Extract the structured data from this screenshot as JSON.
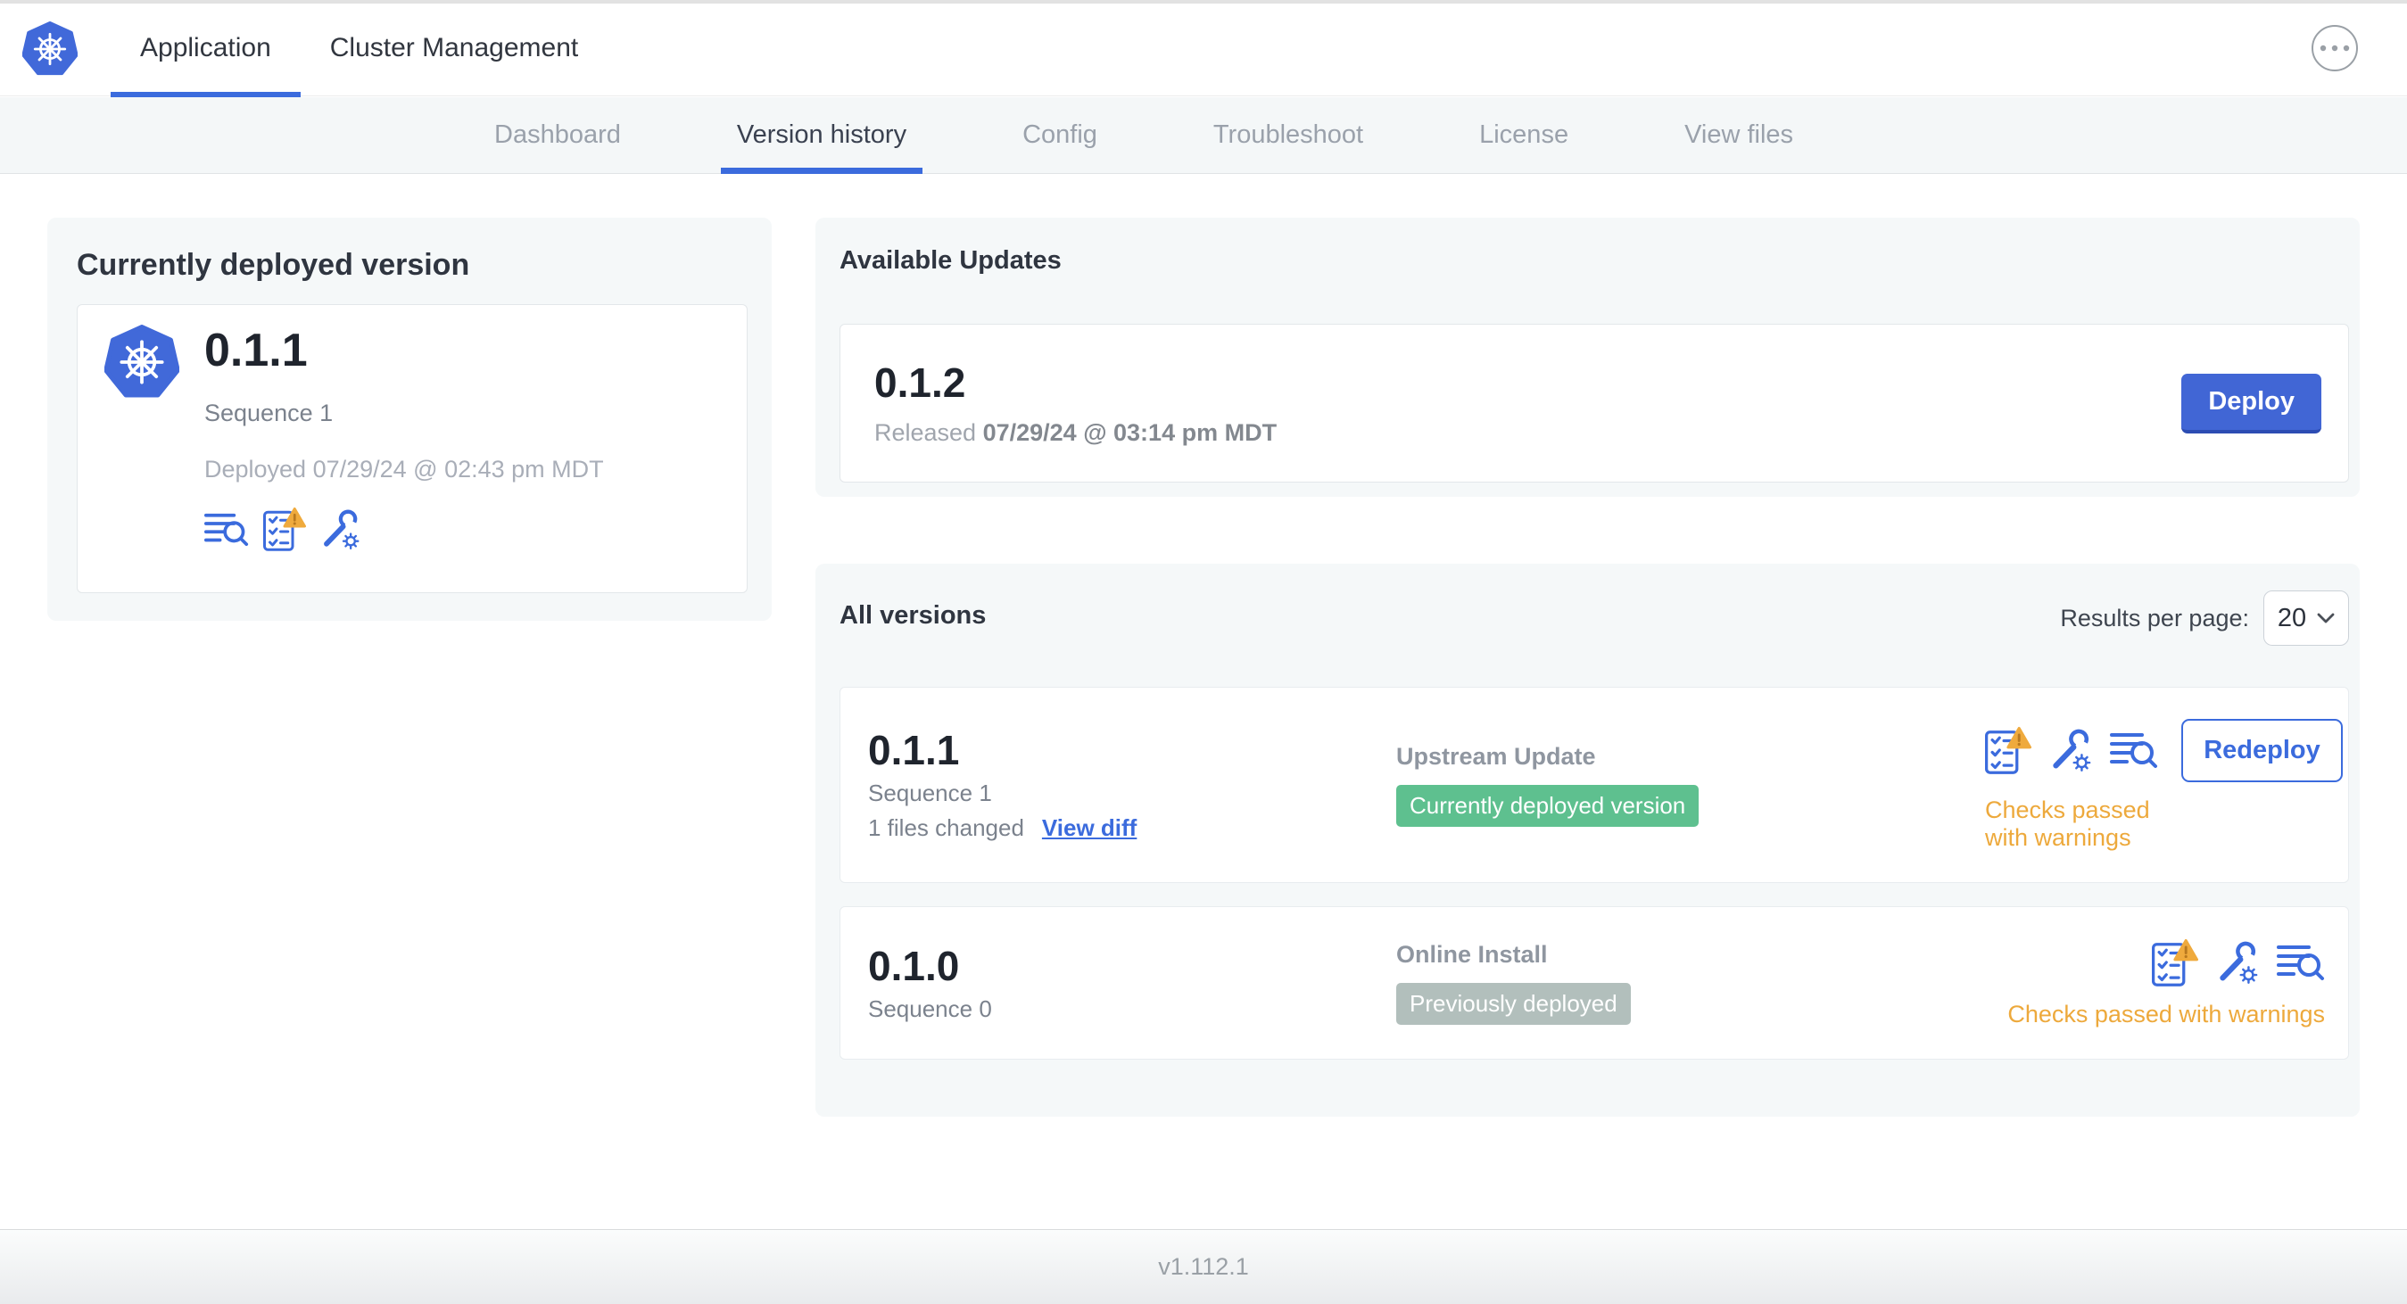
{
  "header": {
    "tabs": [
      {
        "label": "Application"
      },
      {
        "label": "Cluster Management"
      }
    ],
    "overflow_menu_icon": "ellipsis-circle-icon",
    "logo_icon": "kubernetes-logo"
  },
  "subnav": {
    "items": [
      {
        "label": "Dashboard"
      },
      {
        "label": "Version history"
      },
      {
        "label": "Config"
      },
      {
        "label": "Troubleshoot"
      },
      {
        "label": "License"
      },
      {
        "label": "View files"
      }
    ],
    "active": "Version history"
  },
  "current_version": {
    "title": "Currently deployed version",
    "version": "0.1.1",
    "sequence": "Sequence 1",
    "deployed": "Deployed 07/29/24 @ 02:43 pm MDT",
    "icons": [
      "view-logs-icon",
      "preflight-checks-warning-icon",
      "edit-config-icon"
    ]
  },
  "available_updates": {
    "title": "Available Updates",
    "version": "0.1.2",
    "released_prefix": "Released ",
    "released_date": "07/29/24 @ 03:14 pm MDT",
    "deploy_button": "Deploy"
  },
  "all_versions": {
    "title": "All versions",
    "results_per_page_label": "Results per page:",
    "results_per_page_value": "20",
    "rows": [
      {
        "version": "0.1.1",
        "sequence": "Sequence 1",
        "files_changed": "1 files changed",
        "view_diff_link": "View diff",
        "source": "Upstream Update",
        "badge_label": "Currently deployed version",
        "badge_color": "#5ec08f",
        "status_text": "Checks passed with warnings",
        "action_button": "Redeploy",
        "icons": [
          "preflight-checks-warning-icon",
          "edit-config-icon",
          "view-logs-icon"
        ]
      },
      {
        "version": "0.1.0",
        "sequence": "Sequence 0",
        "source": "Online Install",
        "badge_label": "Previously deployed",
        "badge_color": "#b2bfbc",
        "status_text": "Checks passed with warnings",
        "icons": [
          "preflight-checks-warning-icon",
          "edit-config-icon",
          "view-logs-icon"
        ]
      }
    ]
  },
  "footer": {
    "app_version": "v1.112.1"
  },
  "colors": {
    "accent_blue": "#3b6bdd",
    "deploy_blue": "#4166d5",
    "logo_blue": "#4169d9",
    "badge_green": "#5ec08f",
    "badge_gray": "#b2bfbc",
    "warning_orange": "#eda93c",
    "panel_background": "#f5f8f9"
  }
}
